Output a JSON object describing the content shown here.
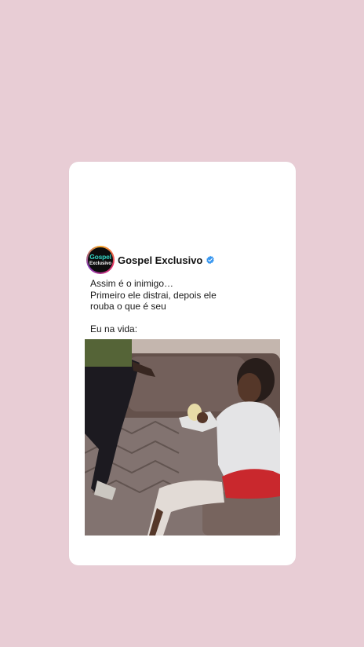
{
  "post": {
    "avatar": {
      "line1": "Gospel",
      "line2": "Exclusivo"
    },
    "account_name": "Gospel Exclusivo",
    "verified": true,
    "caption_lines": [
      "Assim é o inimigo…",
      "Primeiro ele distrai, depois ele",
      "rouba o que é seu"
    ],
    "caption_footer": "Eu na vida:",
    "media_icon": "video-frame-meme"
  },
  "colors": {
    "background": "#e8cdd5",
    "card": "#ffffff",
    "verified": "#3897f0",
    "avatar_accent": "#34d6c4"
  }
}
